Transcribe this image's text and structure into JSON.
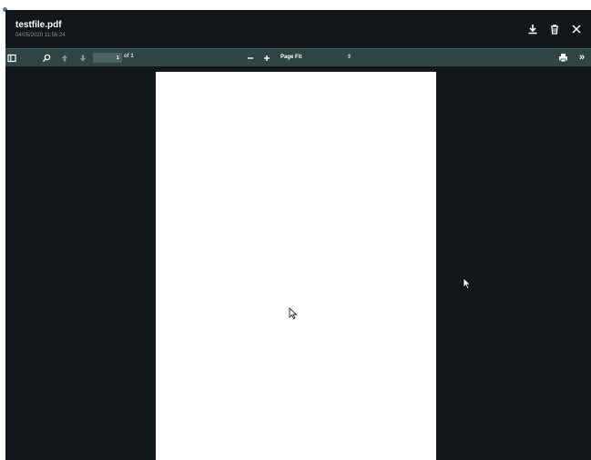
{
  "file": {
    "name": "testfile.pdf",
    "date": "04/05/2020 11:56:24"
  },
  "header_actions": [
    {
      "name": "download",
      "icon": "download-icon"
    },
    {
      "name": "delete",
      "icon": "trash-icon"
    },
    {
      "name": "close",
      "icon": "close-icon"
    }
  ],
  "toolbar": {
    "icons": [
      "sidebar-toggle-icon",
      "search-icon",
      "arrow-up-icon",
      "arrow-down-icon",
      "zoom-out-icon",
      "zoom-in-icon",
      "print-icon",
      "more-tools-icon"
    ],
    "page_number": "1",
    "page_count": "of 1",
    "zoom_out_label": "−",
    "zoom_in_label": "+",
    "zoom_value": "Page Fit",
    "more_label": "»"
  },
  "colors": {
    "background": "#12171c",
    "toolbar": "#2e4746",
    "page": "#ffffff"
  }
}
